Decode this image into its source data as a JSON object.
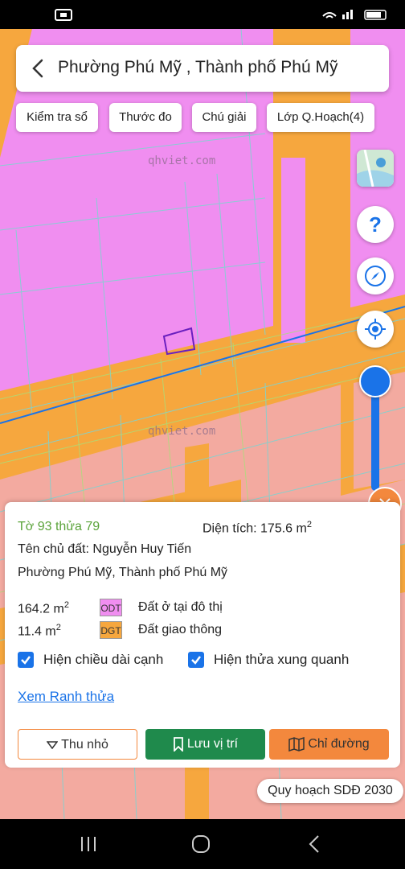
{
  "header": {
    "title": "Phường Phú Mỹ , Thành phố Phú Mỹ"
  },
  "toolbar": {
    "chips": [
      "Kiểm tra sổ",
      "Thước đo",
      "Chú giải",
      "Lớp Q.Hoạch(4)"
    ]
  },
  "map": {
    "watermark": "qhviet.com",
    "colors": {
      "residential": "#f08ef0",
      "transport": "#f6a73e",
      "other": "#f3aaa0"
    }
  },
  "info": {
    "parcel_id": "Tờ 93 thửa 79",
    "area_label": "Diện tích: 175.6 m",
    "area_sup": "2",
    "owner": "Tên chủ đất: Nguyễn Huy Tiến",
    "address": "Phường Phú Mỹ, Thành phố Phú Mỹ",
    "land_uses": [
      {
        "area": "164.2 m",
        "sup": "2",
        "code": "ODT",
        "name": "Đất ở tại đô thị",
        "color": "#f08ef0"
      },
      {
        "area": "11.4 m",
        "sup": "2",
        "code": "DGT",
        "name": "Đất giao thông",
        "color": "#f6a73e"
      }
    ],
    "checkbox_edges": "Hiện chiều dài cạnh",
    "checkbox_neighbors": "Hiện thửa xung quanh",
    "link_boundary": "Xem Ranh thửa",
    "btn_collapse": "Thu nhỏ",
    "btn_save": "Lưu vị trí",
    "btn_directions": "Chỉ đường"
  },
  "plan_badge": "Quy hoạch SDĐ 2030"
}
